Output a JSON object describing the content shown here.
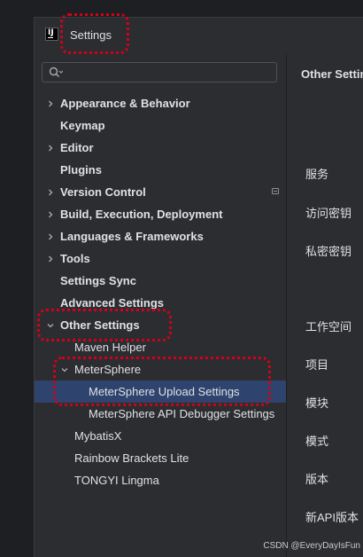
{
  "window": {
    "title": "Settings",
    "app_icon": "intellij-idea-icon"
  },
  "search": {
    "value": "",
    "placeholder": ""
  },
  "tree": [
    {
      "label": "Appearance & Behavior",
      "expander": "collapsed",
      "bold": true
    },
    {
      "label": "Keymap",
      "expander": "none",
      "bold": true
    },
    {
      "label": "Editor",
      "expander": "collapsed",
      "bold": true
    },
    {
      "label": "Plugins",
      "expander": "none",
      "bold": true
    },
    {
      "label": "Version Control",
      "expander": "collapsed",
      "bold": true,
      "badge": "project-scope-icon"
    },
    {
      "label": "Build, Execution, Deployment",
      "expander": "collapsed",
      "bold": true
    },
    {
      "label": "Languages & Frameworks",
      "expander": "collapsed",
      "bold": true
    },
    {
      "label": "Tools",
      "expander": "collapsed",
      "bold": true
    },
    {
      "label": "Settings Sync",
      "expander": "none",
      "bold": true
    },
    {
      "label": "Advanced Settings",
      "expander": "none",
      "bold": true
    },
    {
      "label": "Other Settings",
      "expander": "expanded",
      "bold": true
    },
    {
      "label": "Maven Helper",
      "expander": "none",
      "bold": false
    },
    {
      "label": "MeterSphere",
      "expander": "expanded",
      "bold": false
    },
    {
      "label": "MeterSphere Upload Settings",
      "expander": "none",
      "bold": false,
      "selected": true
    },
    {
      "label": "MeterSphere API Debugger Settings",
      "expander": "none",
      "bold": false
    },
    {
      "label": "MybatisX",
      "expander": "none",
      "bold": false
    },
    {
      "label": "Rainbow Brackets Lite",
      "expander": "none",
      "bold": false
    },
    {
      "label": "TONGYI Lingma",
      "expander": "none",
      "bold": false
    }
  ],
  "content": {
    "title": "Other Settin",
    "fields": [
      "服务",
      "访问密钥",
      "私密密钥",
      "工作空间",
      "项目",
      "模块",
      "模式",
      "版本",
      "新API版本"
    ]
  },
  "watermark": "CSDN @EveryDayIsFun",
  "colors": {
    "window_bg": "#2b2d30",
    "selection_bg": "#2e436e",
    "highlight_annotation": "#d0021b",
    "text": "#dfe1e5"
  }
}
